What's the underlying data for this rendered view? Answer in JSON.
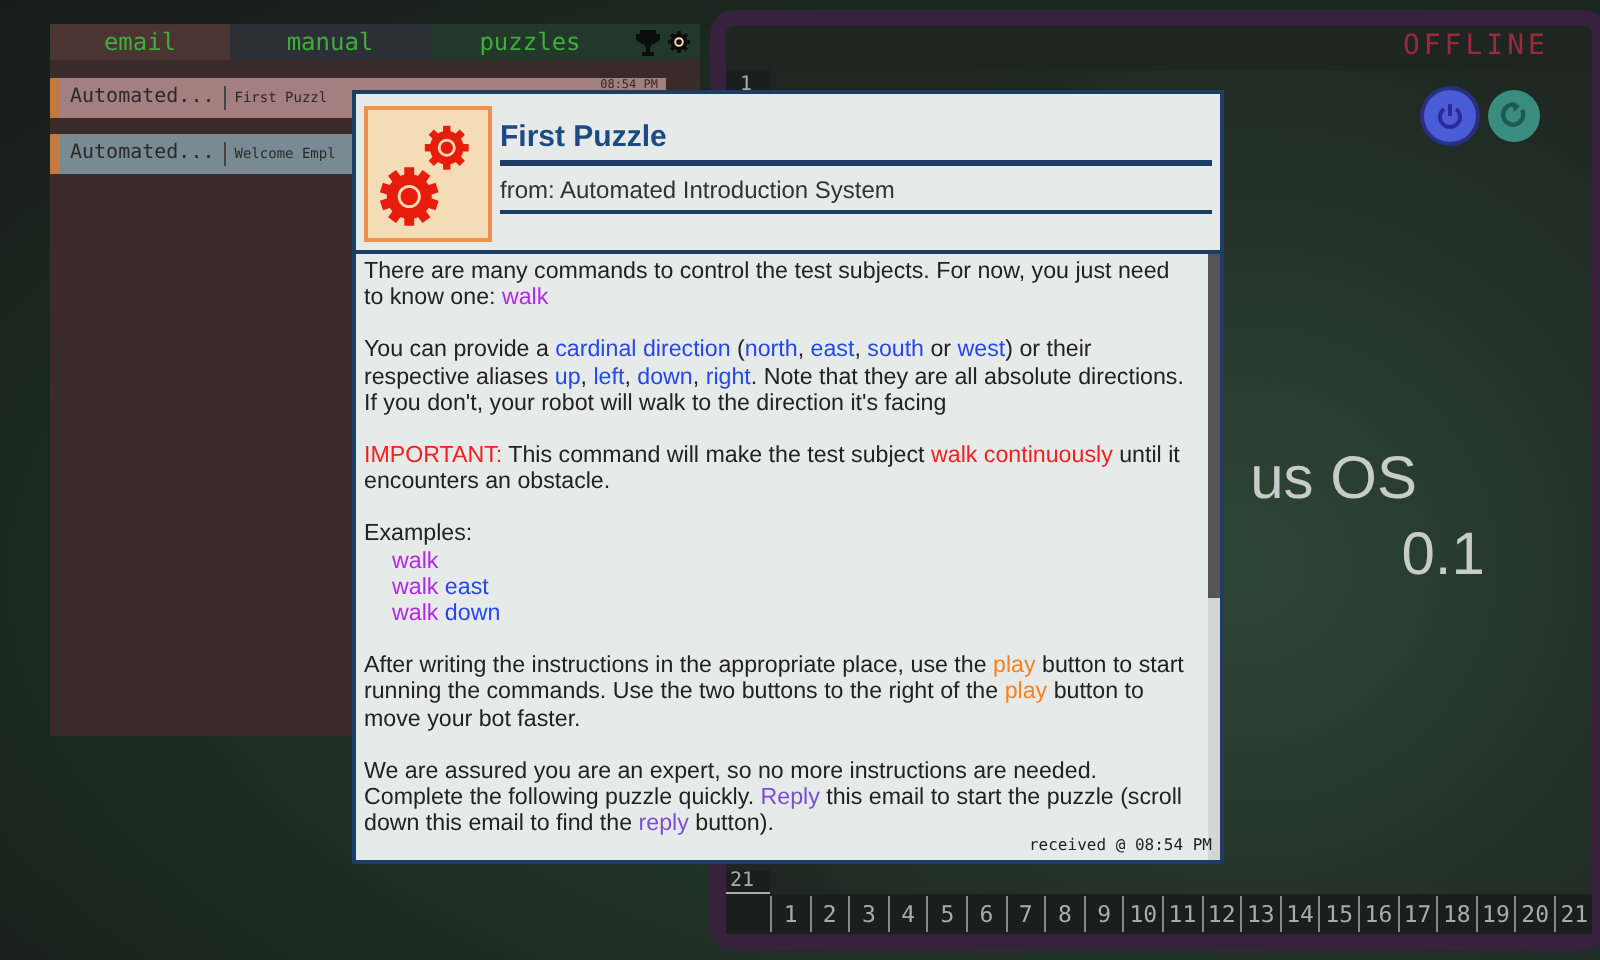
{
  "tabs": [
    {
      "label": "email",
      "selected": true
    },
    {
      "label": "manual",
      "selected": false
    },
    {
      "label": "puzzles",
      "selected": false
    }
  ],
  "emails": [
    {
      "sender": "Automated...",
      "subject": "First Puzzl",
      "time": "08:54 PM",
      "selected": true
    },
    {
      "sender": "Automated...",
      "subject": "Welcome Empl",
      "selected": false
    }
  ],
  "status": "OFFLINE",
  "editor": {
    "first_line": "1",
    "last_line": "21",
    "logo_text": "us OS",
    "version": "0.1",
    "ruler": [
      "1",
      "2",
      "3",
      "4",
      "5",
      "6",
      "7",
      "8",
      "9",
      "10",
      "11",
      "12",
      "13",
      "14",
      "15",
      "16",
      "17",
      "18",
      "19",
      "20",
      "21"
    ]
  },
  "message": {
    "title": "First Puzzle",
    "from": "from: Automated Introduction System",
    "received": "received @ 08:54 PM",
    "blocks": [
      {
        "kind": "text",
        "segments": [
          {
            "text": "There are many commands to control the test subjects. For now, you just need to know one: ",
            "kind": "plain"
          },
          {
            "text": "walk",
            "kind": "command"
          }
        ]
      },
      {
        "kind": "text",
        "segments": [
          {
            "text": "You can provide a ",
            "kind": "plain"
          },
          {
            "text": "cardinal direction",
            "kind": "direction"
          },
          {
            "text": " (",
            "kind": "plain"
          },
          {
            "text": "north",
            "kind": "direction"
          },
          {
            "text": ", ",
            "kind": "plain"
          },
          {
            "text": "east",
            "kind": "direction"
          },
          {
            "text": ", ",
            "kind": "plain"
          },
          {
            "text": "south",
            "kind": "direction"
          },
          {
            "text": " or ",
            "kind": "plain"
          },
          {
            "text": "west",
            "kind": "direction"
          },
          {
            "text": ") or their respective aliases ",
            "kind": "plain"
          },
          {
            "text": "up",
            "kind": "direction"
          },
          {
            "text": ", ",
            "kind": "plain"
          },
          {
            "text": "left",
            "kind": "direction"
          },
          {
            "text": ", ",
            "kind": "plain"
          },
          {
            "text": "down",
            "kind": "direction"
          },
          {
            "text": ", ",
            "kind": "plain"
          },
          {
            "text": "right",
            "kind": "direction"
          },
          {
            "text": ". Note that they are all absolute directions. If you don't, your robot will walk to the direction it's facing",
            "kind": "plain"
          }
        ]
      },
      {
        "kind": "text",
        "segments": [
          {
            "text": "IMPORTANT:",
            "kind": "alert"
          },
          {
            "text": " This command will make the test subject ",
            "kind": "plain"
          },
          {
            "text": "walk continuously",
            "kind": "alert"
          },
          {
            "text": " until it encounters an obstacle.",
            "kind": "plain"
          }
        ]
      },
      {
        "kind": "examples",
        "heading": "Examples:",
        "items": [
          [
            {
              "text": "walk",
              "kind": "command"
            }
          ],
          [
            {
              "text": "walk",
              "kind": "command"
            },
            {
              "text": " east",
              "kind": "direction"
            }
          ],
          [
            {
              "text": "walk",
              "kind": "command"
            },
            {
              "text": " down",
              "kind": "direction"
            }
          ]
        ]
      },
      {
        "kind": "text",
        "segments": [
          {
            "text": "After writing the instructions in the appropriate place, use the ",
            "kind": "plain"
          },
          {
            "text": "play",
            "kind": "button"
          },
          {
            "text": " button to start running the commands. Use the two buttons to the right of the ",
            "kind": "plain"
          },
          {
            "text": "play",
            "kind": "button"
          },
          {
            "text": " button to move your bot faster.",
            "kind": "plain"
          }
        ]
      },
      {
        "kind": "text",
        "segments": [
          {
            "text": "We are assured you are an expert, so no more instructions are needed. Complete the following puzzle quickly. ",
            "kind": "plain"
          },
          {
            "text": "Reply",
            "kind": "reply"
          },
          {
            "text": " this email to start the puzzle (scroll down this email to find the ",
            "kind": "plain"
          },
          {
            "text": "reply",
            "kind": "reply"
          },
          {
            "text": " button).",
            "kind": "plain"
          }
        ]
      }
    ]
  }
}
